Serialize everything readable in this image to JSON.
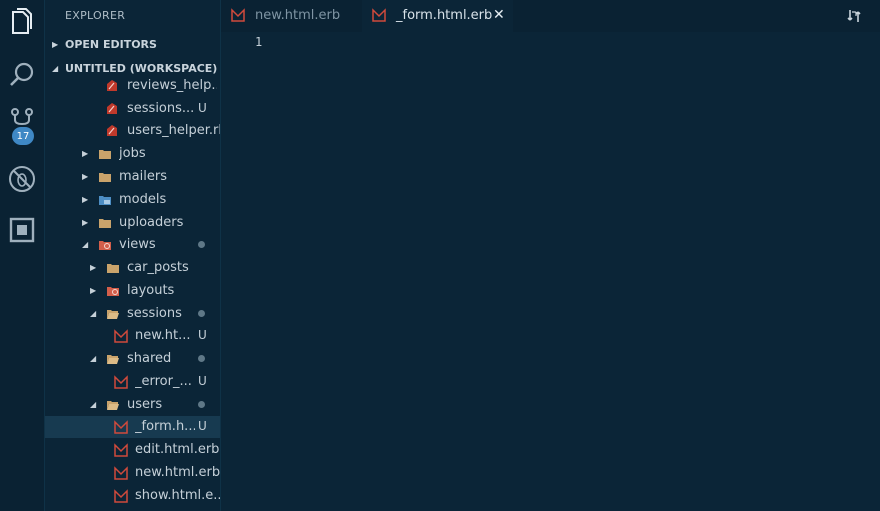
{
  "activity_bar": {
    "scm_badge": "17",
    "icons": [
      "files-icon",
      "search-icon",
      "source-control-icon",
      "debug-icon",
      "extensions-icon"
    ]
  },
  "sidebar": {
    "title": "EXPLORER",
    "sections": {
      "open_editors": "OPEN EDITORS",
      "workspace": "UNTITLED (WORKSPACE)"
    },
    "items": [
      {
        "label": "reviews_help...",
        "status": ""
      },
      {
        "label": "sessions...",
        "status": "U"
      },
      {
        "label": "users_helper.rb",
        "status": ""
      },
      {
        "label": "jobs",
        "status": ""
      },
      {
        "label": "mailers",
        "status": ""
      },
      {
        "label": "models",
        "status": ""
      },
      {
        "label": "uploaders",
        "status": ""
      },
      {
        "label": "views",
        "status": ""
      },
      {
        "label": "car_posts",
        "status": ""
      },
      {
        "label": "layouts",
        "status": ""
      },
      {
        "label": "sessions",
        "status": ""
      },
      {
        "label": "new.ht...",
        "status": "U"
      },
      {
        "label": "shared",
        "status": ""
      },
      {
        "label": "_error_...",
        "status": "U"
      },
      {
        "label": "users",
        "status": ""
      },
      {
        "label": "_form.h...",
        "status": "U"
      },
      {
        "label": "edit.html.erb",
        "status": ""
      },
      {
        "label": "new.html.erb",
        "status": ""
      },
      {
        "label": "show.html.e...",
        "status": ""
      }
    ]
  },
  "tabs": [
    {
      "label": "new.html.erb"
    },
    {
      "label": "_form.html.erb"
    }
  ],
  "editor": {
    "line_number": "1"
  },
  "colors": {
    "background": "#0b2537",
    "accent_badge": "#3f88c5",
    "ruby_red": "#c0392b",
    "folder": "#c9a36b"
  }
}
